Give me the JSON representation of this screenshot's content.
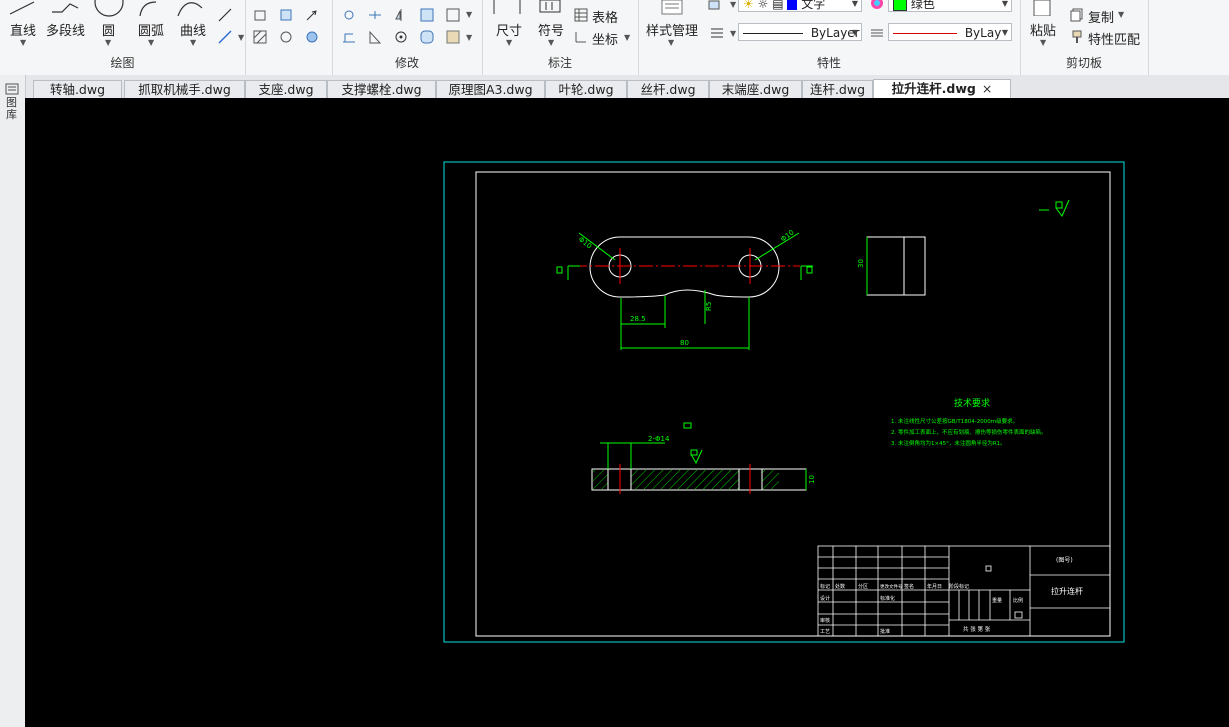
{
  "ribbon": {
    "draw": {
      "title": "绘图",
      "line": "直线",
      "polyline": "多段线",
      "circle": "圆",
      "arc": "圆弧",
      "curve": "曲线"
    },
    "modify": {
      "title": "修改"
    },
    "annotate": {
      "title": "标注",
      "dimension": "尺寸",
      "symbol": "符号",
      "table": "表格",
      "coordinate": "坐标"
    },
    "properties": {
      "title": "特性",
      "style_manager": "样式管理",
      "text_style": "文字",
      "color": "绿色",
      "linetype": "ByLayer",
      "lineweight": "ByLay"
    },
    "clipboard": {
      "title": "剪切板",
      "paste": "粘贴",
      "copy": "复制",
      "match_props": "特性匹配"
    }
  },
  "sidebar": {
    "label": "图库"
  },
  "tabs": [
    {
      "label": "转轴.dwg"
    },
    {
      "label": "抓取机械手.dwg"
    },
    {
      "label": "支座.dwg"
    },
    {
      "label": "支撑螺栓.dwg"
    },
    {
      "label": "原理图A3.dwg"
    },
    {
      "label": "叶轮.dwg"
    },
    {
      "label": "丝杆.dwg"
    },
    {
      "label": "末端座.dwg"
    },
    {
      "label": "连杆.dwg"
    },
    {
      "label": "拉升连杆.dwg",
      "active": true
    }
  ],
  "drawing": {
    "dims": {
      "d_left": "Φ10",
      "d_right": "Φ10",
      "dist_28": "28.5",
      "r_small": "R5",
      "len_80": "80",
      "h_30": "30",
      "thick_10": "10",
      "hole_note": "2-Φ14"
    },
    "tech_req": {
      "title": "技术要求",
      "lines": [
        "1. 未注线性尺寸公差按GB/T1804-2000m级要求。",
        "2. 零件加工表面上，不应有划痕、擦伤等损伤零件表面的缺陷。",
        "3. 未注倒角均为1×45°，未注圆角半径为R1。"
      ]
    },
    "title_block": {
      "part_name": "拉升连杆",
      "figure_no": "(图号)",
      "labels": [
        "标记",
        "处数",
        "分区",
        "更改文件号",
        "签名",
        "年月日",
        "设计",
        "标准化",
        "阶段标记",
        "重量",
        "比例",
        "审核",
        "工艺",
        "批准",
        "共 张 第 张"
      ]
    }
  },
  "colors": {
    "canvas_bg": "#000000",
    "dim_green": "#00ff00",
    "center_red": "#ff0000",
    "border_cyan": "#00e5e5",
    "outline_white": "#ffffff"
  }
}
